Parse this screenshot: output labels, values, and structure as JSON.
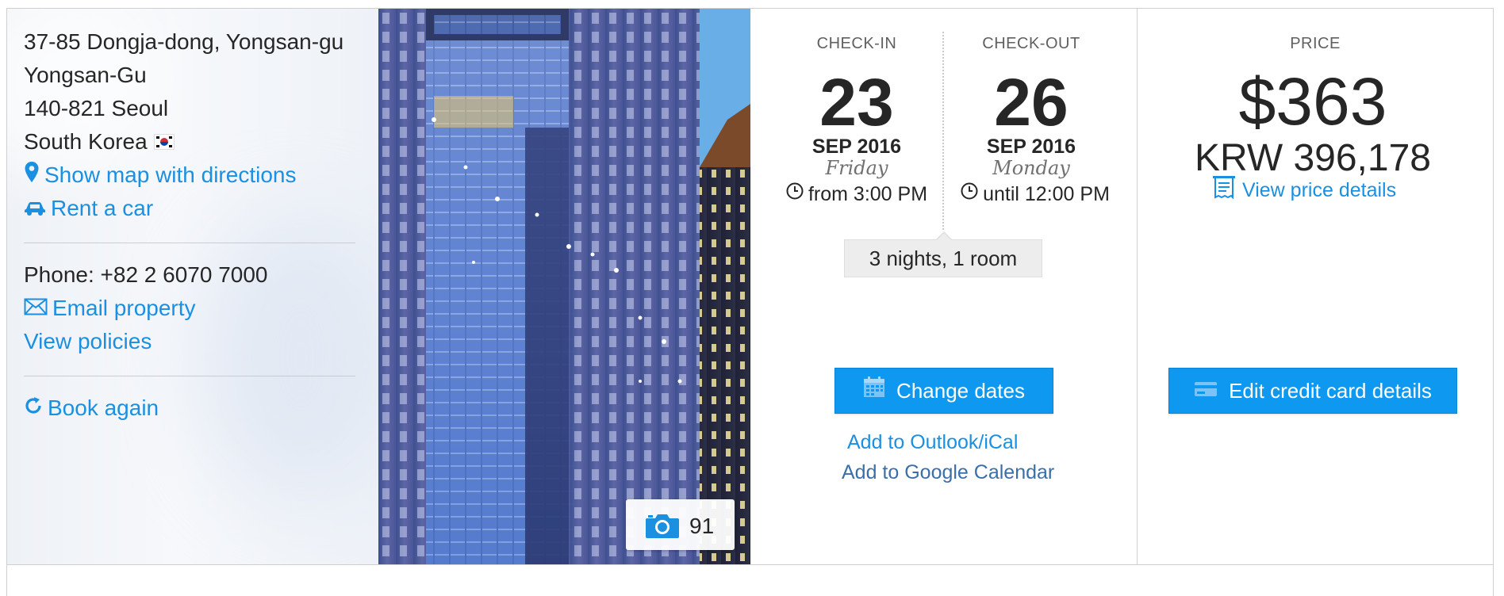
{
  "address": {
    "lines": [
      "37-85 Dongja-dong, Yongsan-gu",
      "Yongsan-Gu",
      "140-821 Seoul",
      "South Korea"
    ],
    "map_link": "Show map with directions",
    "car_link": "Rent a car",
    "phone": "Phone: +82 2 6070 7000",
    "email_link": "Email property",
    "policies_link": "View policies",
    "book_again_link": "Book again"
  },
  "photos": {
    "count": "91",
    "icon": "camera-icon"
  },
  "checkin": {
    "label": "CHECK-IN",
    "day": "23",
    "month_year": "SEP 2016",
    "weekday": "Friday",
    "time": "from 3:00 PM"
  },
  "checkout": {
    "label": "CHECK-OUT",
    "day": "26",
    "month_year": "SEP 2016",
    "weekday": "Monday",
    "time": "until 12:00 PM"
  },
  "stay": {
    "summary": "3 nights, 1 room",
    "change_dates": "Change dates",
    "add_outlook": "Add to Outlook/iCal",
    "add_google": "Add to Google Calendar"
  },
  "price": {
    "label": "PRICE",
    "usd": "$363",
    "krw": "KRW 396,178",
    "details_link": "View price details",
    "edit_card": "Edit credit card details"
  },
  "colors": {
    "link": "#1b8fe0",
    "button": "#0f98f0",
    "text": "#262626"
  }
}
